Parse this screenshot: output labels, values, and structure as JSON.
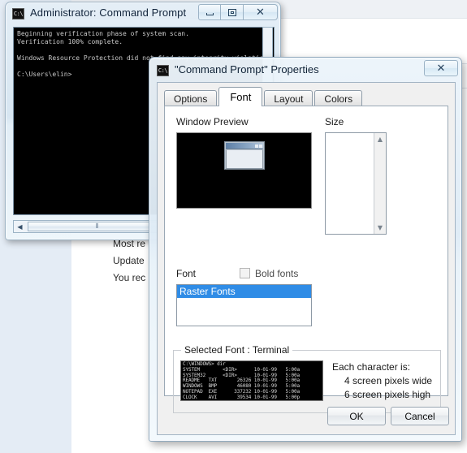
{
  "desktop": {
    "background_text": [
      "Most re",
      "Update",
      "You rec"
    ]
  },
  "console_window": {
    "title": "Administrator: Command Prompt",
    "icon": "command-prompt-icon",
    "icon_glyph": "C:\\",
    "buttons": {
      "minimize": "minimize-icon",
      "maximize": "maximize-icon",
      "close": "✕"
    },
    "screen_text": "Beginning verification phase of system scan.\nVerification 100% complete.\n\nWindows Resource Protection did not find any integrity violations.\n\nC:\\Users\\elin>",
    "hscroll": {
      "left_arrow": "◀",
      "thumb_grip": "⦀"
    }
  },
  "dialog": {
    "title": "\"Command Prompt\" Properties",
    "icon": "command-prompt-icon",
    "icon_glyph": "C:\\",
    "close_label": "✕",
    "tabs": [
      {
        "label": "Options",
        "active": false
      },
      {
        "label": "Font",
        "active": true
      },
      {
        "label": "Layout",
        "active": false
      },
      {
        "label": "Colors",
        "active": false
      }
    ],
    "font_tab": {
      "window_preview_label": "Window Preview",
      "size_label": "Size",
      "size_options": [],
      "font_label": "Font",
      "bold_fonts_label": "Bold fonts",
      "bold_fonts_checked": false,
      "font_list": [
        {
          "name": "Raster Fonts",
          "selected": true
        }
      ],
      "selected_font_group_label": "Selected Font : Terminal",
      "sample_text": "C:\\WINDOWS> dir\nSYSTEM        <DIR>      10-01-99   5:00a\nSYSTEM32      <DIR>      10-01-99   5:00a\nREADME   TXT       26326 10-01-99   5:00a\nWINDOWS  BMP       46080 10-01-99   5:00a\nNOTEPAD  EXE      337232 10-01-99   5:00a\nCLOCK    AVI       39534 10-01-99   5:00p",
      "char_info_heading": "Each character is:",
      "char_width_text": "4 screen pixels wide",
      "char_height_text": "6 screen pixels high"
    },
    "ok_label": "OK",
    "cancel_label": "Cancel"
  },
  "colors": {
    "selection_blue": "#2f8ce6",
    "console_black": "#000000",
    "dialog_face": "#f0f0f0",
    "desktop_panel": "#e4ecf5"
  }
}
